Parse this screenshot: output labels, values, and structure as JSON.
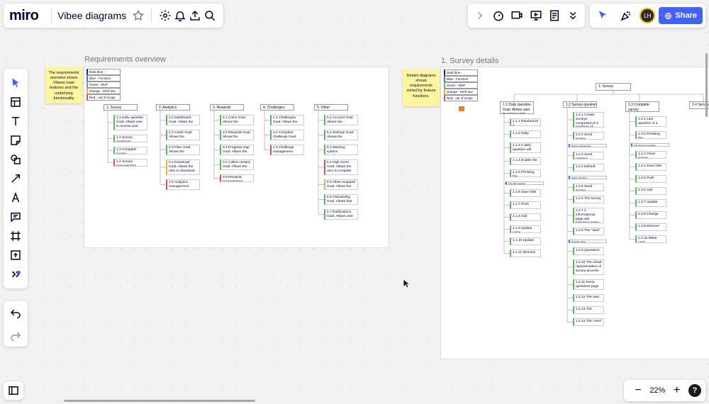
{
  "app": {
    "logo": "miro",
    "board_title": "Vibee diagrams"
  },
  "bottom": {
    "zoom": "22%",
    "zoom_out": "−",
    "zoom_in": "+",
    "help": "?"
  },
  "share_label": "Share",
  "avatar_initials": "LH",
  "colors": {
    "accent": "#4262ff",
    "function": "#4a6fd8",
    "mvp": "#5cb85c",
    "mvp_low": "#f0ad4e",
    "out_of_scope": "#d9534f",
    "sticky": "#fff59d"
  },
  "frames": [
    {
      "title": "Requirements overview",
      "sticky": "The requirements overview shows Vibees main features and the underlying functionality",
      "legend": [
        "Dark blue -",
        "Blue - Function",
        "Green - MVP",
        "Orange - MVP low",
        "Red - out of scope"
      ],
      "columns": [
        {
          "header": "1. Survey",
          "items": [
            {
              "text": "1.1 Daily question Goal: Allows user to recieve and",
              "c": "mvp"
            },
            {
              "text": "1.2 Survey questions",
              "c": "mvp"
            },
            {
              "text": "1.3 Complete survey",
              "c": "mvp"
            },
            {
              "text": "1.4 Survey management",
              "c": "out_of_scope"
            }
          ]
        },
        {
          "header": "2. Analytics",
          "items": [
            {
              "text": "2.1 Dashboard Goal: Allows the",
              "c": "mvp"
            },
            {
              "text": "2.2 Cards Goal: Allows the",
              "c": "mvp"
            },
            {
              "text": "2.3 Filter Goal: Allows the",
              "c": "mvp"
            },
            {
              "text": "2.4 Download Goal: Allows the user to download",
              "c": "mvp_low"
            },
            {
              "text": "2.5 Analytics management",
              "c": "out_of_scope"
            }
          ]
        },
        {
          "header": "3. Rewards",
          "items": [
            {
              "text": "3.1 Coins Goal: Allows the",
              "c": "mvp"
            },
            {
              "text": "3.2 Rewards Goal: Allows the",
              "c": "mvp"
            },
            {
              "text": "3.3 Progress map Goal: Allows the",
              "c": "mvp"
            },
            {
              "text": "3.4 Collect reward Goal: Allows the",
              "c": "mvp"
            },
            {
              "text": "3.5 Rewards management",
              "c": "out_of_scope"
            }
          ]
        },
        {
          "header": "4. Challenges",
          "items": [
            {
              "text": "4.1 Challenges Goal: Allows the",
              "c": "mvp"
            },
            {
              "text": "4.2 Complete challenge Goal: Allows the",
              "c": "mvp"
            },
            {
              "text": "4.3 Challenge management",
              "c": "out_of_scope"
            }
          ]
        },
        {
          "header": "5. Other",
          "items": [
            {
              "text": "5.1 Account Goal: Allows the",
              "c": "mvp"
            },
            {
              "text": "5.2 Settings Goal: Allows the",
              "c": "mvp"
            },
            {
              "text": "5.3 Warning system (notifications)",
              "c": "mvp"
            },
            {
              "text": "5.4 High score Goal: Allows the user to compete",
              "c": "out_of_scope"
            },
            {
              "text": "5.5 Vibee wrapped Goal: Allows the",
              "c": "mvp_low"
            },
            {
              "text": "5.6 Onboarding Goal: Allows first",
              "c": "mvp"
            },
            {
              "text": "5.7 Notifications Goal: Allows user",
              "c": "mvp"
            }
          ]
        }
      ]
    },
    {
      "title": "1. Survey details",
      "sticky": "Details diagrams shows requirements sorted by feature functions.",
      "legend": [
        "Dark blue -",
        "Blue - Function",
        "Green - MVP",
        "Orange - MVP low",
        "Red - out of scope"
      ],
      "root": "1. Survey",
      "columns": [
        {
          "header": "1.1 Daily question Goal: Allows user to recieve and",
          "items": [
            {
              "text": "1.1.1 Randomize a",
              "c": "mvp"
            },
            {
              "text": "1.1.2 Daily",
              "c": "mvp"
            },
            {
              "text": "1.1.3 A daily question will contain:",
              "c": "mvp"
            },
            {
              "text": "1.1.4 Enable the",
              "c": "mvp"
            },
            {
              "text": "1.1.5 Pressing the",
              "c": "mvp"
            },
            {
              "text": "The daily question",
              "c": "function"
            },
            {
              "text": "1.1.6 Save NMI",
              "c": "mvp"
            },
            {
              "text": "1.1.7 Push",
              "c": "mvp"
            },
            {
              "text": "1.1.8 Add",
              "c": "mvp"
            },
            {
              "text": "1.1.9 Update coins",
              "c": "mvp"
            },
            {
              "text": "1.1.10 Update",
              "c": "mvp"
            },
            {
              "text": "1.1.11 Remove",
              "c": "mvp"
            }
          ]
        },
        {
          "header": "1.2 Survey questions",
          "items": [
            {
              "text": "1.2.1 Create surveys composed of X numbers of",
              "c": "mvp"
            },
            {
              "text": "1.2.2 Send survey",
              "c": "mvp"
            },
            {
              "text": "Survey requirements",
              "c": "function"
            },
            {
              "text": "1.2.3 Send created",
              "c": "mvp"
            },
            {
              "text": "1.2.4 Default",
              "c": "mvp"
            },
            {
              "text": "Survey structure",
              "c": "function"
            },
            {
              "text": "1.2.5 Send survey",
              "c": "mvp"
            },
            {
              "text": "1.2.6 The survey",
              "c": "mvp"
            },
            {
              "text": "1.2.7 A informational page will introduce every survey containing",
              "c": "mvp"
            },
            {
              "text": "1.2.8 The \"start\"",
              "c": "mvp"
            },
            {
              "text": "Question page",
              "c": "function"
            },
            {
              "text": "1.2.9 Questions",
              "c": "mvp"
            },
            {
              "text": "1.2.10 The visual representation of survey-process",
              "c": "mvp"
            },
            {
              "text": "1.2.11 Every questions page",
              "c": "mvp"
            },
            {
              "text": "1.2.12 The user",
              "c": "mvp"
            },
            {
              "text": "1.2.13 The",
              "c": "mvp"
            },
            {
              "text": "1.2.14 The \"next\"",
              "c": "mvp"
            }
          ]
        },
        {
          "header": "1.3 Complete survey",
          "items": [
            {
              "text": "1.3.1 Last question of a",
              "c": "mvp"
            },
            {
              "text": "1.3.2 Pressing the",
              "c": "mvp"
            },
            {
              "text": "The survey is complete",
              "c": "function"
            },
            {
              "text": "1.3.3 Close survey",
              "c": "mvp"
            },
            {
              "text": "1.3.4 Save NMI",
              "c": "mvp"
            },
            {
              "text": "1.3.5 Push",
              "c": "mvp"
            },
            {
              "text": "1.3.6 Add",
              "c": "mvp"
            },
            {
              "text": "1.3.7 Update",
              "c": "mvp"
            },
            {
              "text": "1.3.8 Change",
              "c": "mvp"
            },
            {
              "text": "1.3.9 Remove",
              "c": "mvp"
            },
            {
              "text": "1.3.10 Make card",
              "c": "mvp"
            }
          ]
        },
        {
          "header": "1.4 Survey management",
          "items": []
        }
      ]
    }
  ]
}
